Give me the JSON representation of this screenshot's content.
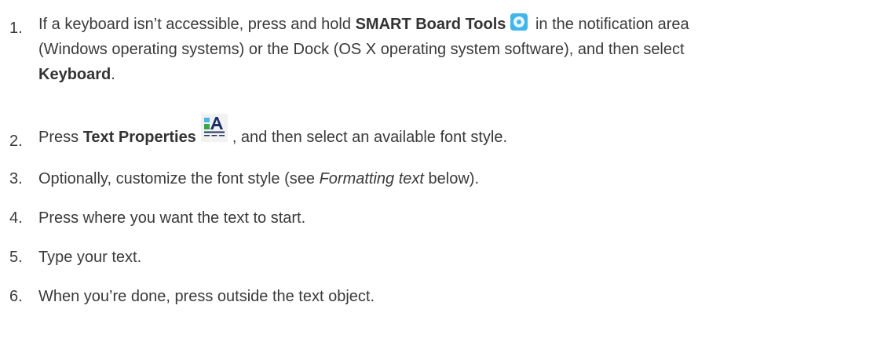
{
  "steps": [
    {
      "number": "1.",
      "part1": "If a keyboard isn’t accessible, press and hold ",
      "bold1": "SMART Board Tools",
      "part2": " in the notification area",
      "line2": "(Windows operating systems) or the Dock (OS X operating system software), and then select",
      "bold2": "Keyboard",
      "end": ".",
      "icon": "smart-board-tools-icon"
    },
    {
      "number": "2.",
      "part1": "Press ",
      "bold1": "Text Properties",
      "part2": ", and then select an available font style.",
      "icon": "text-properties-icon"
    },
    {
      "number": "3.",
      "part1": "Optionally, customize the font style (see ",
      "italic": "Formatting text",
      "part2": " below)."
    },
    {
      "number": "4.",
      "text": "Press where you want the text to start."
    },
    {
      "number": "5.",
      "text": "Type your text."
    },
    {
      "number": "6.",
      "text": "When you’re done, press outside the text object."
    }
  ]
}
